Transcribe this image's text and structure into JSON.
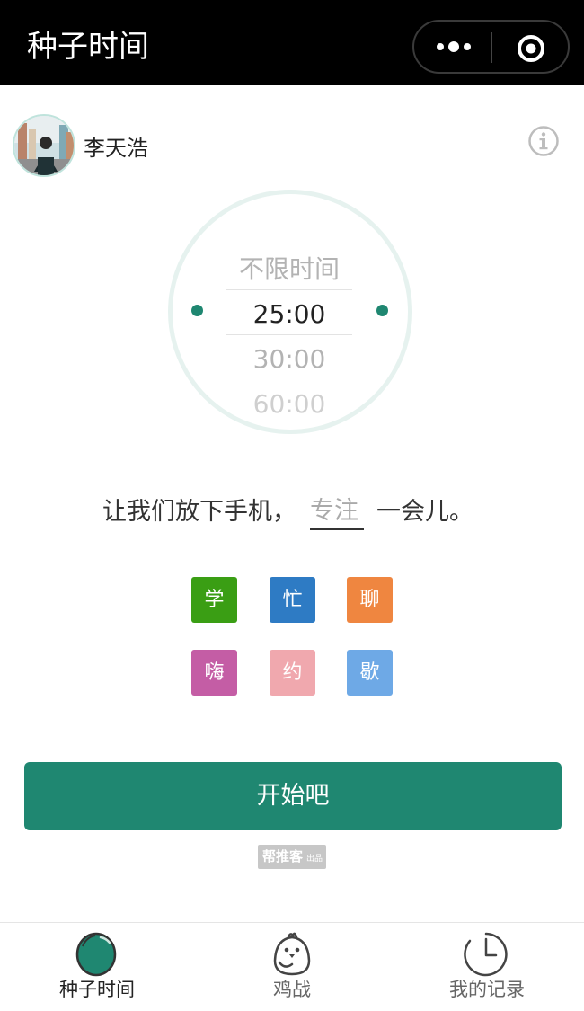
{
  "topbar": {
    "title": "种子时间",
    "more_icon": "ellipsis-icon",
    "close_icon": "target-circle-icon"
  },
  "user": {
    "name": "李天浩",
    "avatar_icon": "user-avatar"
  },
  "info_icon": "info-circle-icon",
  "timer": {
    "options": [
      "不限时间",
      "25:00",
      "30:00",
      "60:00"
    ],
    "selected": "25:00"
  },
  "slogan": {
    "prefix": "让我们放下手机，",
    "placeholder": "专注",
    "suffix": "一会儿。"
  },
  "tags": [
    {
      "label": "学",
      "color": "#3a9e14"
    },
    {
      "label": "忙",
      "color": "#2e7bc4"
    },
    {
      "label": "聊",
      "color": "#ef8640"
    },
    {
      "label": "嗨",
      "color": "#c45da5"
    },
    {
      "label": "约",
      "color": "#f0a8ae"
    },
    {
      "label": "歇",
      "color": "#6ea9e6"
    }
  ],
  "start_button": "开始吧",
  "credit": {
    "brand": "帮推客",
    "suffix": "出品"
  },
  "tabbar": {
    "items": [
      {
        "label": "种子时间",
        "icon": "seed-icon",
        "active": true
      },
      {
        "label": "鸡战",
        "icon": "chick-icon",
        "active": false
      },
      {
        "label": "我的记录",
        "icon": "clock-record-icon",
        "active": false
      }
    ]
  },
  "colors": {
    "accent": "#1f8771",
    "topbar": "#000000",
    "dial_ring": "#e6f2ef"
  }
}
